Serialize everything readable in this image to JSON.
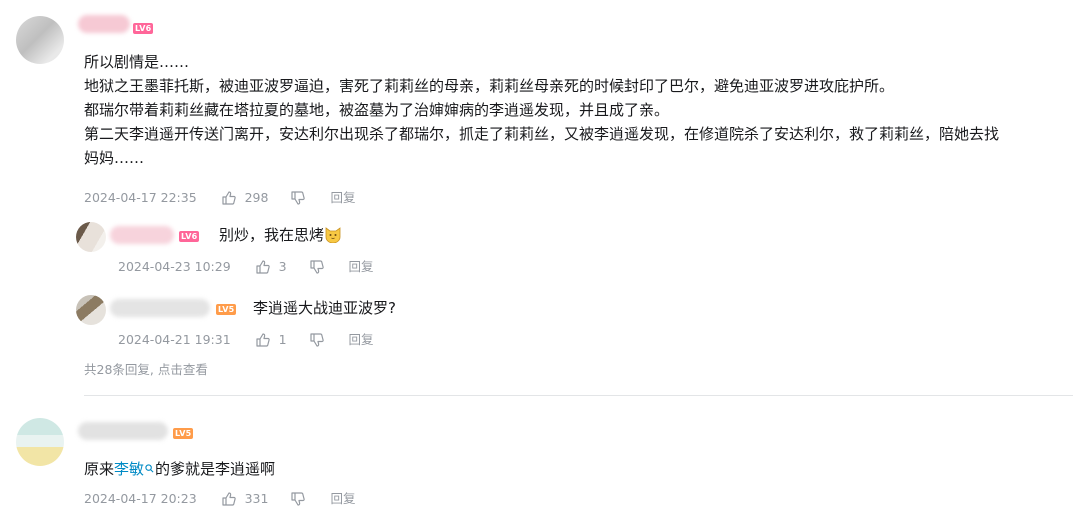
{
  "comments": [
    {
      "level": "LV6",
      "lines": [
        "所以剧情是……",
        "地狱之王墨菲托斯，被迪亚波罗逼迫，害死了莉莉丝的母亲，莉莉丝母亲死的时候封印了巴尔，避免迪亚波罗进攻庇护所。",
        "都瑞尔带着莉莉丝藏在塔拉夏的墓地，被盗墓为了治婶婶病的李逍遥发现，并且成了亲。",
        "第二天李逍遥开传送门离开，安达利尔出现杀了都瑞尔，抓走了莉莉丝，又被李逍遥发现，在修道院杀了安达利尔，救了莉莉丝，陪她去找",
        "妈妈……"
      ],
      "time": "2024-04-17 22:35",
      "likes": "298",
      "reply_label": "回复",
      "replies": [
        {
          "level": "LV6",
          "text": "别炒，我在思烤",
          "emoji": "cat-emoji",
          "time": "2024-04-23 10:29",
          "likes": "3",
          "reply_label": "回复"
        },
        {
          "level": "LV5",
          "text": "李逍遥大战迪亚波罗?",
          "time": "2024-04-21 19:31",
          "likes": "1",
          "reply_label": "回复"
        }
      ],
      "more_replies": "共28条回复, 点击查看"
    },
    {
      "level": "LV5",
      "text_prefix": "原来",
      "text_link": "李敏",
      "text_suffix": "的爹就是李逍遥啊",
      "time": "2024-04-17 20:23",
      "likes": "331",
      "reply_label": "回复"
    }
  ],
  "colors": {
    "meta": "#9499a0",
    "text": "#18191c",
    "link": "#008ac5",
    "level6": "#ff6699",
    "level5": "#ff9c4a",
    "divider": "#e3e5e7"
  },
  "icons": [
    "thumb-up-icon",
    "thumb-down-icon",
    "search-link-icon",
    "cat-emoji"
  ]
}
